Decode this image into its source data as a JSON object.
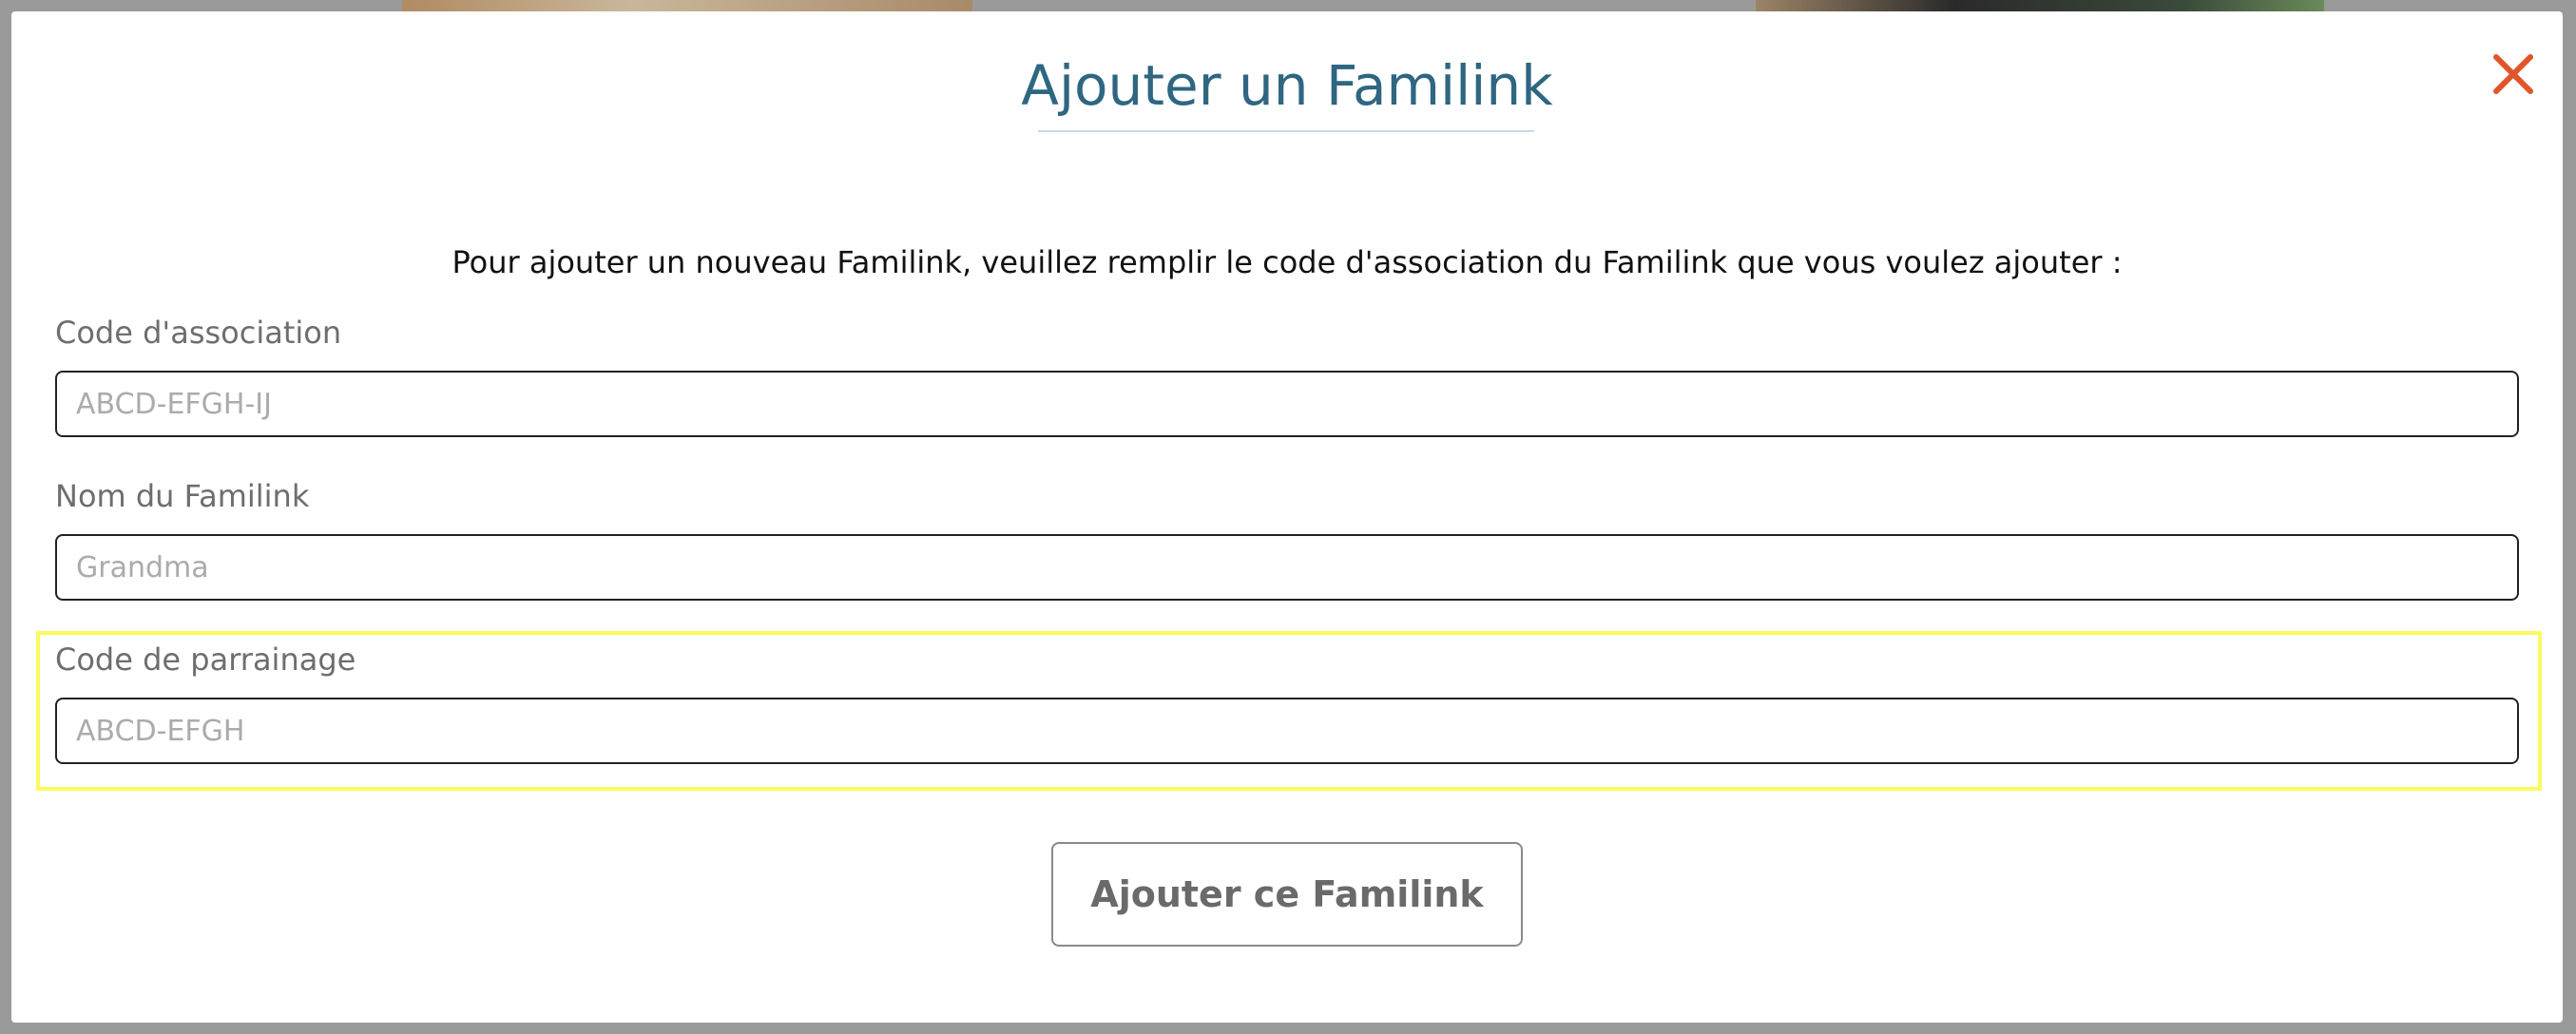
{
  "modal": {
    "title": "Ajouter un Familink",
    "close_icon": "close-icon",
    "intro": "Pour ajouter un nouveau Familink, veuillez remplir le code d'association du Familink que vous voulez ajouter :"
  },
  "form": {
    "association_code": {
      "label": "Code d'association",
      "placeholder": "ABCD-EFGH-IJ",
      "value": ""
    },
    "familink_name": {
      "label": "Nom du Familink",
      "placeholder": "Grandma",
      "value": ""
    },
    "referral_code": {
      "label": "Code de parrainage",
      "placeholder": "ABCD-EFGH",
      "value": ""
    },
    "submit_label": "Ajouter ce Familink"
  },
  "colors": {
    "title": "#2f6682",
    "close": "#e0552a",
    "highlight": "#fbfb60",
    "overlay": "#9a9a9a"
  }
}
